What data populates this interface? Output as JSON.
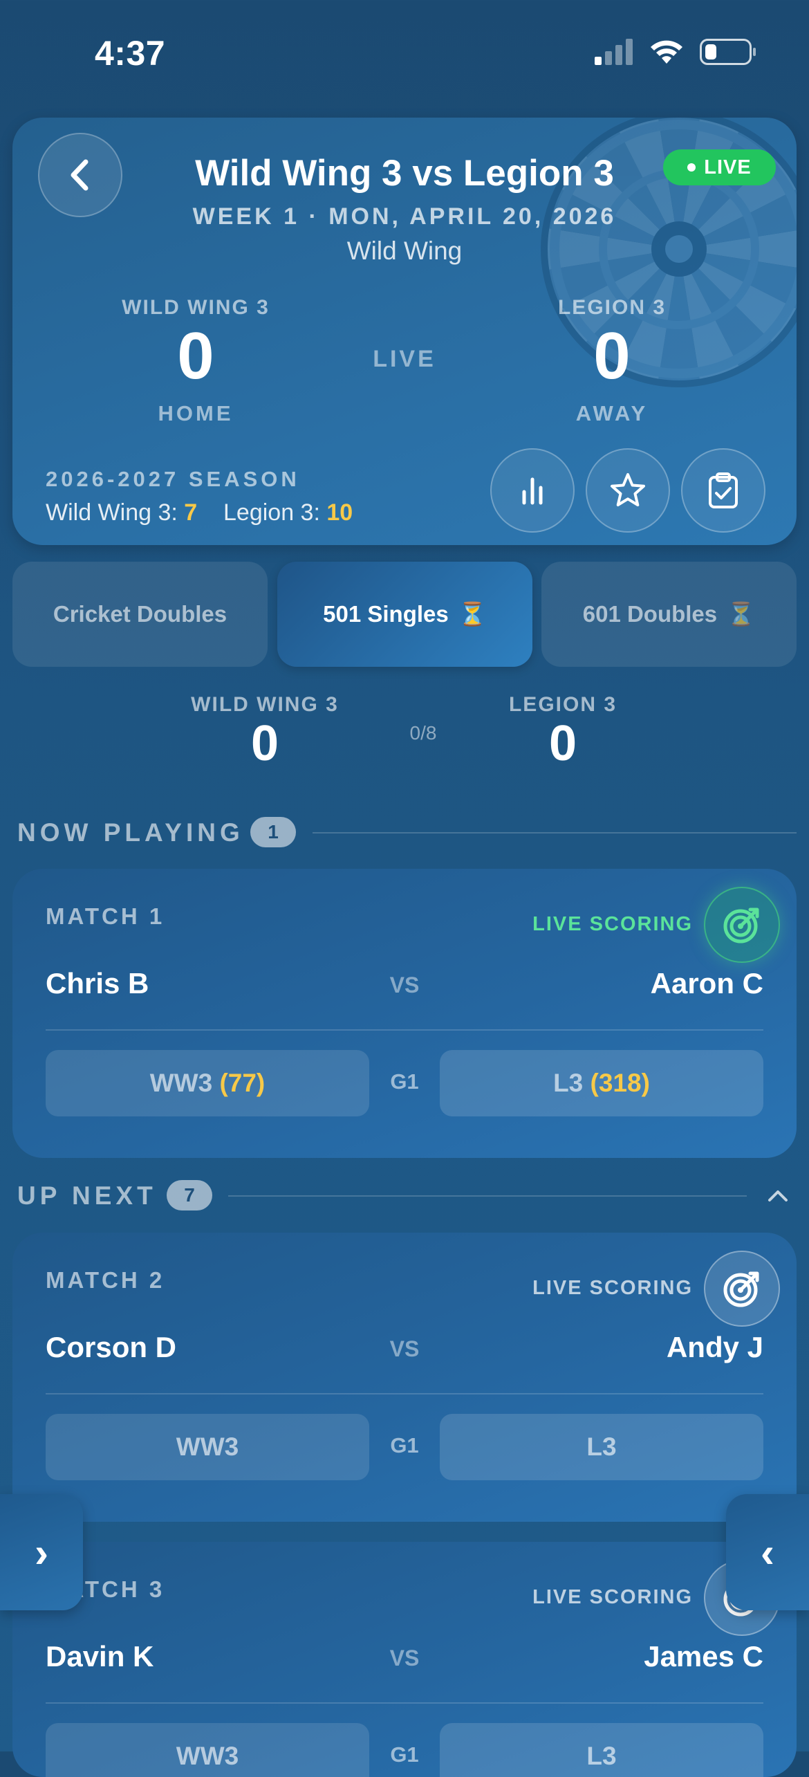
{
  "status_bar": {
    "time": "4:37"
  },
  "header": {
    "title": "Wild Wing 3 vs Legion 3",
    "live_badge": "LIVE",
    "subtitle": "WEEK 1 · MON, APRIL 20, 2026",
    "venue": "Wild Wing",
    "home": {
      "name": "WILD WING 3",
      "score": "0",
      "side": "HOME"
    },
    "away": {
      "name": "LEGION 3",
      "score": "0",
      "side": "AWAY"
    },
    "status": "LIVE",
    "season": {
      "label": "2026-2027 SEASON",
      "home_name": "Wild Wing 3:",
      "home_points": "7",
      "away_name": "Legion 3:",
      "away_points": "10"
    },
    "icons": [
      "back-chevron-icon",
      "bar-chart-icon",
      "star-icon",
      "clipboard-check-icon"
    ]
  },
  "tabs": [
    {
      "label": "Cricket Doubles",
      "active": false,
      "icon": ""
    },
    {
      "label": "501 Singles",
      "active": true,
      "icon": "⏳"
    },
    {
      "label": "601 Doubles",
      "active": false,
      "icon": "⏳"
    }
  ],
  "game_score": {
    "home_name": "WILD WING 3",
    "home_score": "0",
    "progress": "0/8",
    "away_name": "LEGION 3",
    "away_score": "0"
  },
  "now_playing": {
    "title": "NOW PLAYING",
    "count": "1",
    "match": {
      "title": "MATCH 1",
      "live_scoring": "LIVE SCORING",
      "home_player": "Chris B",
      "vs": "VS",
      "away_player": "Aaron C",
      "home_team": "WW3",
      "home_remaining": "(77)",
      "game": "G1",
      "away_team": "L3",
      "away_remaining": "(318)"
    }
  },
  "up_next": {
    "title": "UP NEXT",
    "count": "7",
    "matches": [
      {
        "title": "MATCH 2",
        "live_scoring": "LIVE SCORING",
        "home_player": "Corson D",
        "vs": "VS",
        "away_player": "Andy J",
        "home_team": "WW3",
        "game": "G1",
        "away_team": "L3"
      },
      {
        "title": "MATCH 3",
        "live_scoring": "LIVE SCORING",
        "home_player": "Davin K",
        "vs": "VS",
        "away_player": "James C",
        "home_team": "WW3",
        "game": "G1",
        "away_team": "L3"
      }
    ]
  },
  "nav_arrows": {
    "left": "›",
    "right": "‹"
  },
  "colors": {
    "accent_green": "#22c55e",
    "highlight_yellow": "#f7c948",
    "background": "#1e5582"
  }
}
